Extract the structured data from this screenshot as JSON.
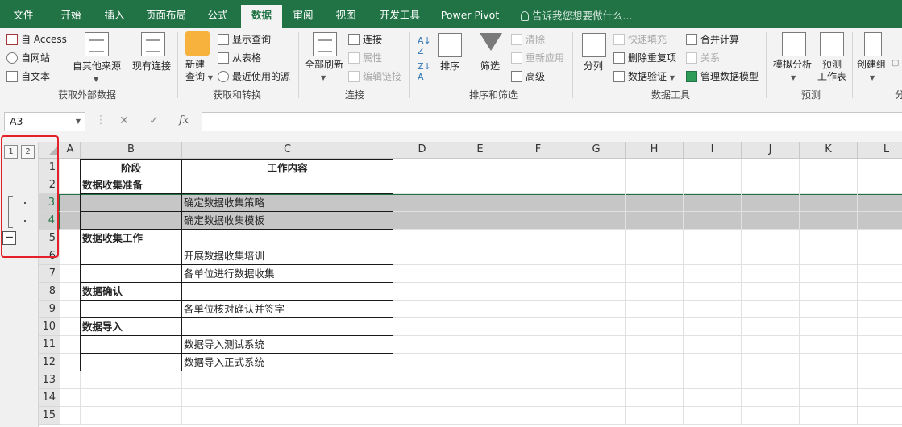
{
  "tabs": [
    "文件",
    "开始",
    "插入",
    "页面布局",
    "公式",
    "数据",
    "审阅",
    "视图",
    "开发工具",
    "Power Pivot"
  ],
  "tell_me": "告诉我您想要做什么...",
  "ribbon": {
    "external": {
      "access": "自 Access",
      "web": "自网站",
      "text": "自文本",
      "other": "自其他来源",
      "existing": "现有连接",
      "label": "获取外部数据"
    },
    "transform": {
      "new_query_1": "新建",
      "new_query_2": "查询",
      "show_queries": "显示查询",
      "from_table": "从表格",
      "recent": "最近使用的源",
      "label": "获取和转换"
    },
    "connections": {
      "refresh_all": "全部刷新",
      "connections": "连接",
      "properties": "属性",
      "edit_links": "编辑链接",
      "label": "连接"
    },
    "sort_filter": {
      "sort": "排序",
      "filter": "筛选",
      "clear": "清除",
      "reapply": "重新应用",
      "advanced": "高级",
      "label": "排序和筛选"
    },
    "data_tools": {
      "split": "分列",
      "flash_fill": "快速填充",
      "remove_dup": "删除重复项",
      "validation": "数据验证",
      "consolidate": "合并计算",
      "relations": "关系",
      "model": "管理数据模型",
      "label": "数据工具"
    },
    "forecast": {
      "whatif": "模拟分析",
      "sheet_1": "预测",
      "sheet_2": "工作表",
      "label": "预测"
    },
    "outline": {
      "group": "创建组",
      "label": "分"
    }
  },
  "formula_bar": {
    "name_box": "A3",
    "fx": "fx",
    "cancel": "✕",
    "enter": "✓"
  },
  "sheet": {
    "columns": [
      "A",
      "B",
      "C",
      "D",
      "E",
      "F",
      "G",
      "H",
      "I",
      "J",
      "K",
      "L"
    ],
    "rows": [
      "1",
      "2",
      "3",
      "4",
      "5",
      "6",
      "7",
      "8",
      "9",
      "10",
      "11",
      "12",
      "13",
      "14",
      "15"
    ],
    "outline_levels": [
      "1",
      "2"
    ],
    "header": {
      "b": "阶段",
      "c": "工作内容"
    },
    "cells": [
      {
        "b": "",
        "c": ""
      },
      {
        "b": "数据收集准备",
        "c": ""
      },
      {
        "b": "",
        "c": "确定数据收集策略"
      },
      {
        "b": "",
        "c": "确定数据收集模板"
      },
      {
        "b": "数据收集工作",
        "c": ""
      },
      {
        "b": "",
        "c": "开展数据收集培训"
      },
      {
        "b": "",
        "c": "各单位进行数据收集"
      },
      {
        "b": "数据确认",
        "c": ""
      },
      {
        "b": "",
        "c": "各单位核对确认并签字"
      },
      {
        "b": "数据导入",
        "c": ""
      },
      {
        "b": "",
        "c": "数据导入测试系统"
      },
      {
        "b": "",
        "c": "数据导入正式系统"
      }
    ],
    "collapse_symbol": "−"
  }
}
